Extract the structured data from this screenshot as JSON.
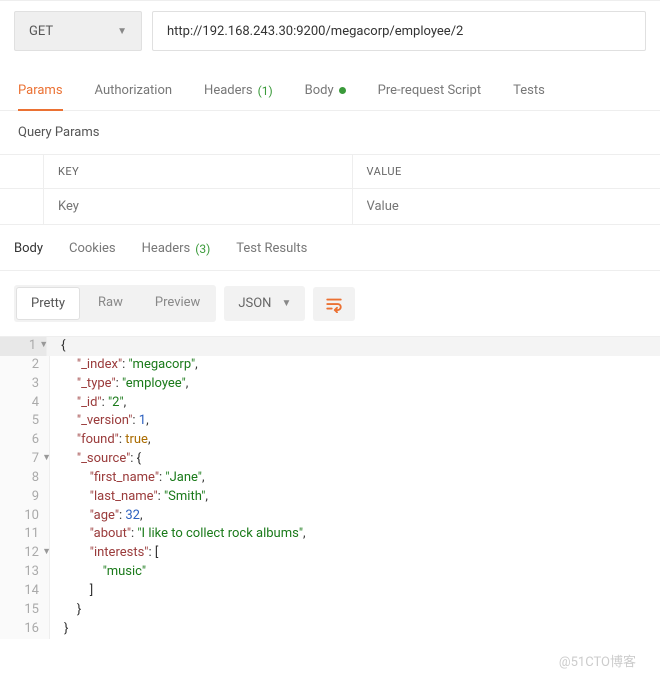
{
  "request": {
    "method": "GET",
    "url": "http://192.168.243.30:9200/megacorp/employee/2"
  },
  "req_tabs": {
    "params": "Params",
    "authorization": "Authorization",
    "headers": "Headers",
    "headers_count": "(1)",
    "body": "Body",
    "prerequest": "Pre-request Script",
    "tests": "Tests"
  },
  "section": {
    "query_params_title": "Query Params",
    "key_header": "KEY",
    "value_header": "VALUE",
    "key_placeholder": "Key",
    "value_placeholder": "Value"
  },
  "resp_tabs": {
    "body": "Body",
    "cookies": "Cookies",
    "headers": "Headers",
    "headers_count": "(3)",
    "test_results": "Test Results"
  },
  "format": {
    "pretty": "Pretty",
    "raw": "Raw",
    "preview": "Preview",
    "json": "JSON"
  },
  "code": {
    "l1": "{",
    "l2a": "\"_index\"",
    "l2b": ": ",
    "l2c": "\"megacorp\"",
    "l2d": ",",
    "l3a": "\"_type\"",
    "l3b": ": ",
    "l3c": "\"employee\"",
    "l3d": ",",
    "l4a": "\"_id\"",
    "l4b": ": ",
    "l4c": "\"2\"",
    "l4d": ",",
    "l5a": "\"_version\"",
    "l5b": ": ",
    "l5c": "1",
    "l5d": ",",
    "l6a": "\"found\"",
    "l6b": ": ",
    "l6c": "true",
    "l6d": ",",
    "l7a": "\"_source\"",
    "l7b": ": {",
    "l8a": "\"first_name\"",
    "l8b": ": ",
    "l8c": "\"Jane\"",
    "l8d": ",",
    "l9a": "\"last_name\"",
    "l9b": ": ",
    "l9c": "\"Smith\"",
    "l9d": ",",
    "l10a": "\"age\"",
    "l10b": ": ",
    "l10c": "32",
    "l10d": ",",
    "l11a": "\"about\"",
    "l11b": ": ",
    "l11c": "\"I like to collect rock albums\"",
    "l11d": ",",
    "l12a": "\"interests\"",
    "l12b": ": [",
    "l13a": "\"music\"",
    "l14": "]",
    "l15": "}",
    "l16": "}",
    "n1": "1",
    "n2": "2",
    "n3": "3",
    "n4": "4",
    "n5": "5",
    "n6": "6",
    "n7": "7",
    "n8": "8",
    "n9": "9",
    "n10": "10",
    "n11": "11",
    "n12": "12",
    "n13": "13",
    "n14": "14",
    "n15": "15",
    "n16": "16"
  },
  "watermark": "@51CTO博客"
}
